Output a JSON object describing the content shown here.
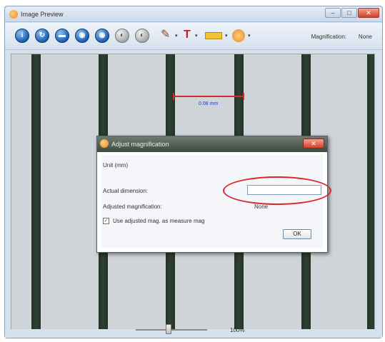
{
  "window": {
    "title": "Image Preview",
    "controls": {
      "minimize": "–",
      "maximize": "□",
      "close": "✕"
    }
  },
  "toolbar": {
    "buttons": [
      {
        "icon": "info-icon",
        "glyph": "i"
      },
      {
        "icon": "refresh-icon",
        "glyph": "↻"
      },
      {
        "icon": "save-icon",
        "glyph": "▬"
      },
      {
        "icon": "open-icon",
        "glyph": "◉"
      },
      {
        "icon": "settings-icon",
        "glyph": "◉"
      },
      {
        "icon": "disabled-1-icon",
        "glyph": "◐"
      },
      {
        "icon": "disabled-2-icon",
        "glyph": "◐"
      }
    ],
    "magnification_label": "Magnification:",
    "magnification_value": "None"
  },
  "viewer": {
    "measurement_label": "0.08 mm",
    "measurement_color": "#d8262b"
  },
  "statusbar": {
    "zoom_level": "100%"
  },
  "dialog": {
    "title": "Adjust magnification",
    "close": "✕",
    "unit": "Unit (mm)",
    "actual_dimension_label": "Actual dimension:",
    "actual_dimension_value": "",
    "adjusted_magnification_label": "Adjusted magnification:",
    "adjusted_magnification_value": "None",
    "checkbox_label": "Use adjusted mag. as measure mag",
    "checkbox_checked": true,
    "ok_label": "OK"
  },
  "colors": {
    "highlight": "#d8262b",
    "line": "#2f4033",
    "viewer_bg": "#cfd4d8"
  }
}
